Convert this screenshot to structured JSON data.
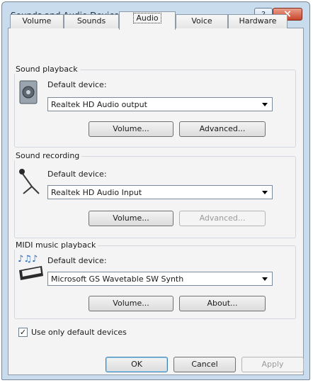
{
  "window": {
    "title": "Sounds and Audio Devices Properties"
  },
  "tabs": [
    {
      "label": "Volume"
    },
    {
      "label": "Sounds"
    },
    {
      "label": "Audio"
    },
    {
      "label": "Voice"
    },
    {
      "label": "Hardware"
    }
  ],
  "active_tab": "Audio",
  "groups": {
    "playback": {
      "label": "Sound playback",
      "device_label": "Default device:",
      "device_value": "Realtek HD Audio output",
      "buttons": [
        {
          "label": "Volume..."
        },
        {
          "label": "Advanced..."
        }
      ]
    },
    "recording": {
      "label": "Sound recording",
      "device_label": "Default device:",
      "device_value": "Realtek HD Audio Input",
      "buttons": [
        {
          "label": "Volume..."
        },
        {
          "label": "Advanced..."
        }
      ]
    },
    "midi": {
      "label": "MIDI music playback",
      "device_label": "Default device:",
      "device_value": "Microsoft GS Wavetable SW Synth",
      "buttons": [
        {
          "label": "Volume..."
        },
        {
          "label": "About..."
        }
      ]
    }
  },
  "checkbox": {
    "label": "Use only default devices",
    "checked": true,
    "mark": "✓"
  },
  "footer": {
    "ok": "OK",
    "cancel": "Cancel",
    "apply": "Apply"
  },
  "titlebar": {
    "help": "?",
    "close": "×"
  }
}
